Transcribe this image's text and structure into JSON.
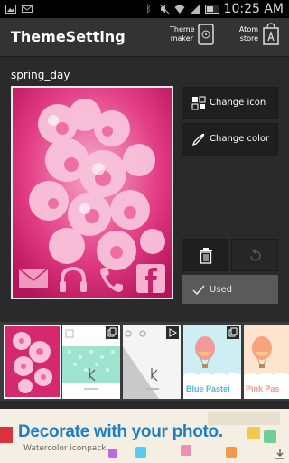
{
  "status_bar": {
    "time": "10:25 AM",
    "icons": [
      "picture-icon",
      "mail-icon",
      "bluetooth-icon",
      "mute-icon",
      "wifi-icon",
      "signal-icon",
      "battery-icon"
    ]
  },
  "header": {
    "title": "ThemeSetting",
    "theme_maker_label": "Theme maker",
    "atom_store_label": "Atom store"
  },
  "theme": {
    "name": "spring_day"
  },
  "buttons": {
    "change_icon": "Change icon",
    "change_color": "Change color",
    "used": "Used"
  },
  "thumbnails": [
    {
      "label": "",
      "selected": true
    },
    {
      "label": "",
      "selected": false
    },
    {
      "label": "",
      "selected": false
    },
    {
      "label": "Blue Pastel",
      "selected": false
    },
    {
      "label": "Pink Pas",
      "selected": false
    }
  ],
  "ad": {
    "title": "Decorate with your photo.",
    "subtitle": "Watercolor iconpack"
  },
  "colors": {
    "header_bg": "#333333",
    "button_bg": "#1f1f1f",
    "used_bg": "#5a5a5a",
    "ad_title": "#1b7fc8"
  }
}
